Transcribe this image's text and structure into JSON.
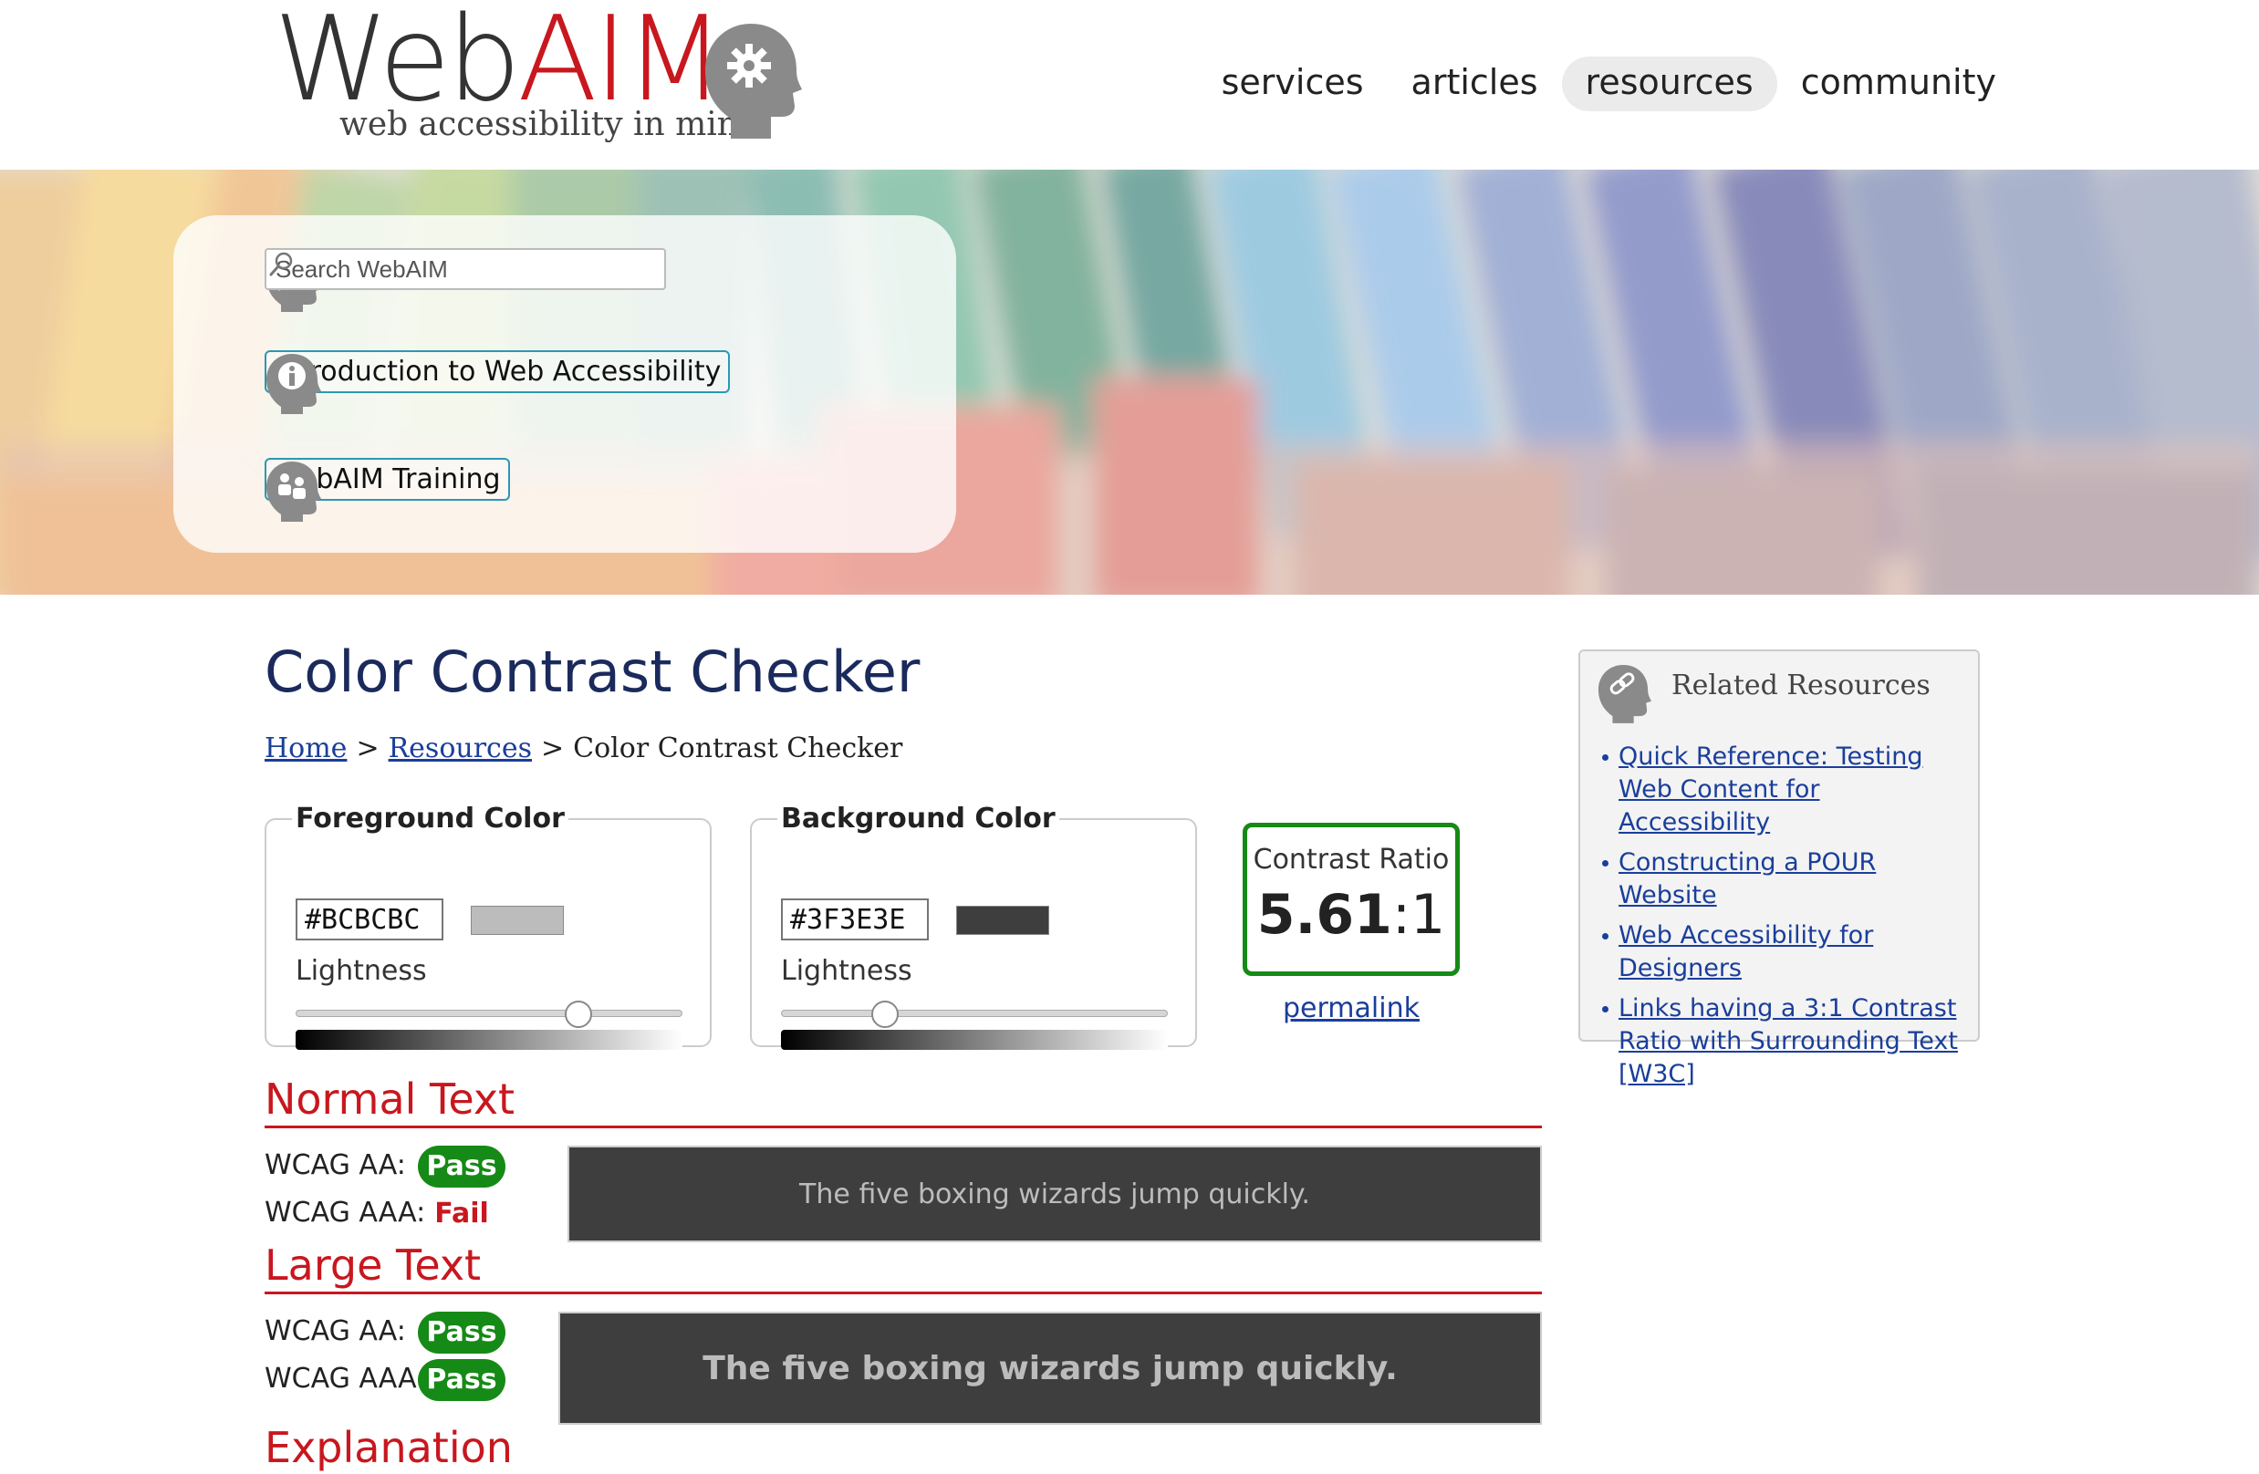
{
  "brand": {
    "name_part1": "Web",
    "name_part2": "AIM",
    "tagline": "web accessibility in mind"
  },
  "nav": {
    "items": [
      {
        "label": "services",
        "active": false
      },
      {
        "label": "articles",
        "active": false
      },
      {
        "label": "resources",
        "active": true
      },
      {
        "label": "community",
        "active": false
      }
    ]
  },
  "banner": {
    "search_placeholder": "Search WebAIM",
    "links": [
      "Introduction to Web Accessibility",
      "WebAIM Training"
    ]
  },
  "main": {
    "title": "Color Contrast Checker",
    "breadcrumb": {
      "home": "Home",
      "resources": "Resources",
      "separator": ">",
      "current": "Color Contrast Checker"
    },
    "foreground": {
      "legend": "Foreground Color",
      "hex": "#BCBCBC",
      "swatch_color": "#bcbcbc",
      "lightness_label": "Lightness",
      "lightness_fraction": 0.73
    },
    "background": {
      "legend": "Background Color",
      "hex": "#3F3E3E",
      "swatch_color": "#3f3e3e",
      "lightness_label": "Lightness",
      "lightness_fraction": 0.27
    },
    "contrast": {
      "label": "Contrast Ratio",
      "ratio_bold": "5.61",
      "ratio_suffix": ":1",
      "permalink": "permalink"
    },
    "normal_text": {
      "heading": "Normal Text",
      "aa_label": "WCAG AA:",
      "aa_result": "Pass",
      "aaa_label": "WCAG AAA:",
      "aaa_result": "Fail",
      "sample": "The five boxing wizards jump quickly."
    },
    "large_text": {
      "heading": "Large Text",
      "aa_label": "WCAG AA:",
      "aa_result": "Pass",
      "aaa_label": "WCAG AAA:",
      "aaa_result": "Pass",
      "sample": "The five boxing wizards jump quickly."
    },
    "explanation_heading": "Explanation"
  },
  "sidebar": {
    "title": "Related Resources",
    "links": [
      "Quick Reference: Testing Web Content for Accessibility",
      "Constructing a POUR Website",
      "Web Accessibility for Designers",
      "Links having a 3:1 Contrast Ratio with Surrounding Text [W3C]"
    ]
  },
  "colors": {
    "brand_red": "#c8171e",
    "link_blue": "#1a3e9b",
    "title_navy": "#1b2a5c",
    "pass_green": "#168a16",
    "sample_bg": "#3f3e3e",
    "sample_fg": "#bcbcbc"
  },
  "icons": [
    "gear-head-logo-icon",
    "search-head-icon",
    "info-head-icon",
    "training-head-icon",
    "magnifier-icon",
    "link-head-icon"
  ]
}
